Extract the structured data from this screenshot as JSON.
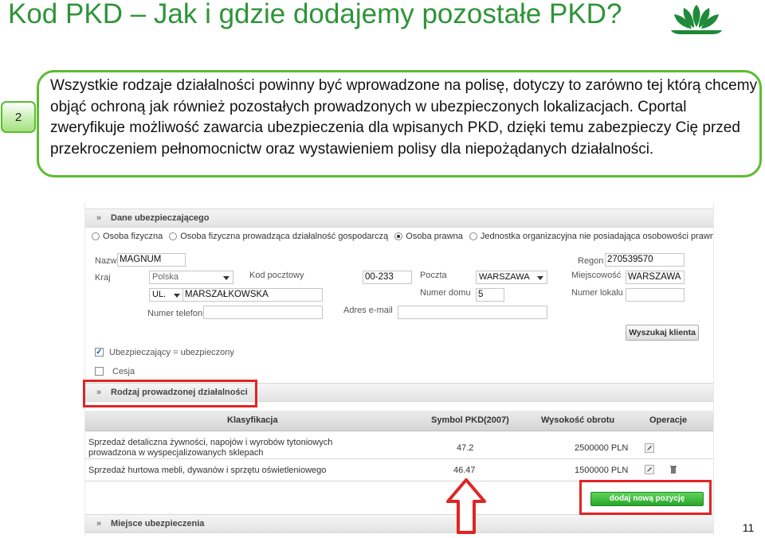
{
  "slide": {
    "title": "Kod PKD – Jak i gdzie dodajemy pozostałe PKD?",
    "step_number": "2",
    "callout_text": "Wszystkie rodzaje działalności powinny być wprowadzone na polisę, dotyczy to zarówno tej którą chcemy objąć ochroną jak również pozostałych prowadzonych w ubezpieczonych lokalizacjach. Cportal zweryfikuje możliwość zawarcia ubezpieczenia dla wpisanych PKD, dzięki temu zabezpieczy Cię przed przekroczeniem pełnomocnictw oraz wystawieniem polisy dla niepożądanych działalności.",
    "page_number": "11",
    "accent_color": "#5bbd2f",
    "title_color": "#2e9438",
    "highlight_color": "#e02424"
  },
  "form": {
    "section_insured": "Dane ubezpieczającego",
    "radio_options": [
      {
        "label": "Osoba fizyczna",
        "selected": false
      },
      {
        "label": "Osoba fizyczna prowadząca działalność gospodarczą",
        "selected": false
      },
      {
        "label": "Osoba prawna",
        "selected": true
      },
      {
        "label": "Jednostka organizacyjna nie posiadająca osobowości prawnej",
        "selected": false
      }
    ],
    "labels": {
      "name": "Nazwa",
      "regon": "Regon",
      "country": "Kraj",
      "postal_code": "Kod pocztowy",
      "post_office": "Poczta",
      "city": "Miejscowość",
      "house_number": "Numer domu",
      "apartment_number": "Numer lokalu",
      "phone": "Numer telefonu",
      "email": "Adres e-mail"
    },
    "values": {
      "name": "MAGNUM",
      "regon": "270539570",
      "country": "Polska",
      "postal_code": "00-233",
      "post_office": "WARSZAWA",
      "city": "WARSZAWA",
      "street_prefix": "UL.",
      "street": "MARSZAŁKOWSKA",
      "house_number": "5"
    },
    "search_client_button": "Wyszukaj klienta",
    "insured_same_label": "Ubezpieczający = ubezpieczony",
    "insured_same_checked": true,
    "assignment_label": "Cesja",
    "assignment_checked": false,
    "section_activity": "Rodzaj prowadzonej działalności",
    "table": {
      "headers": [
        "Klasyfikacja",
        "Symbol PKD(2007)",
        "Wysokość obrotu",
        "Operacje"
      ],
      "rows": [
        {
          "classification": "Sprzedaż detaliczna żywności, napojów i wyrobów tytoniowych prowadzona w wyspecjalizowanych sklepach",
          "pkd": "47.2",
          "turnover": "2500000 PLN"
        },
        {
          "classification": "Sprzedaż hurtowa mebli, dywanów i sprzętu oświetleniowego",
          "pkd": "46.47",
          "turnover": "1500000 PLN"
        }
      ]
    },
    "add_item_button": "dodaj nową pozycję",
    "section_location": "Miejsce ubezpieczenia"
  }
}
